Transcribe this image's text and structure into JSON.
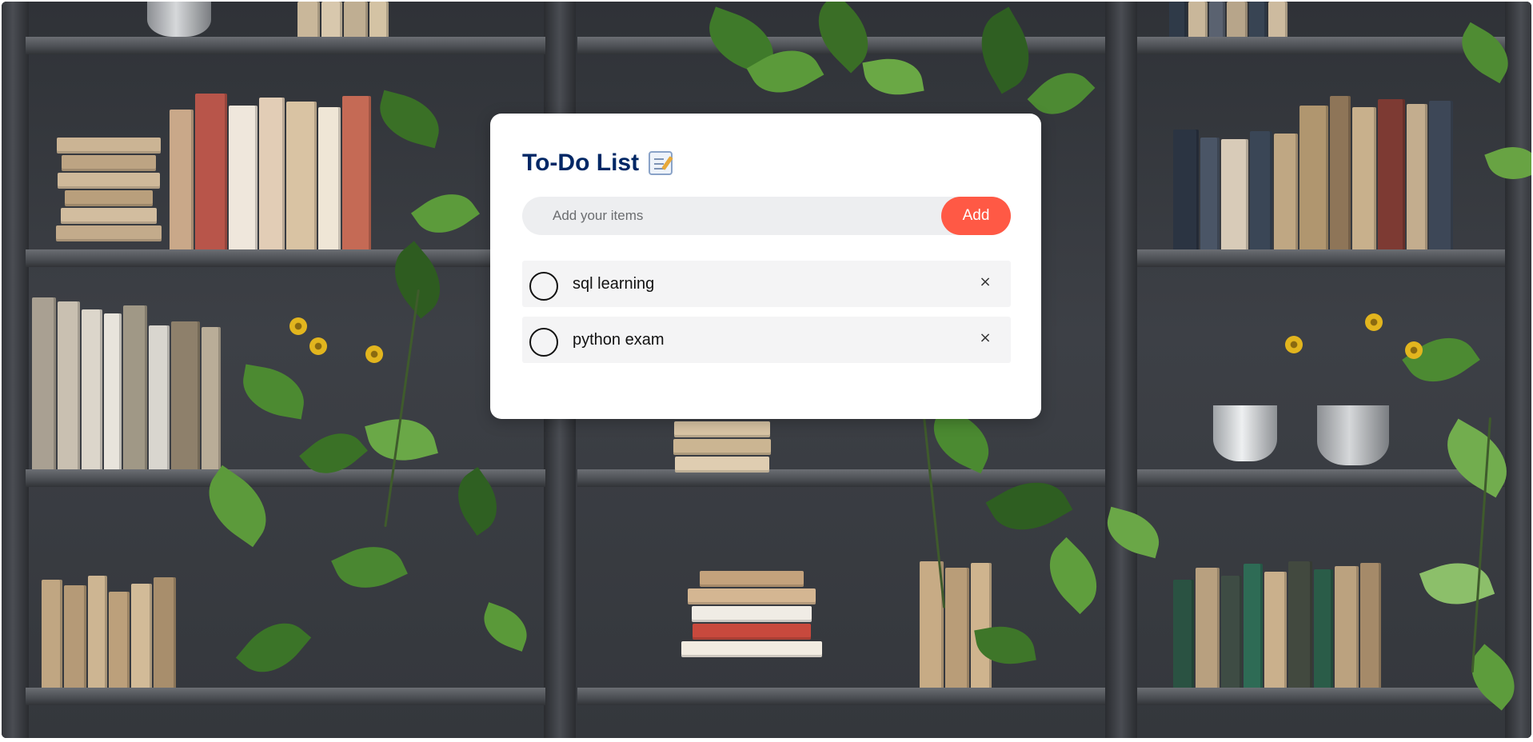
{
  "app": {
    "title": "To-Do List",
    "title_icon": "memo-icon"
  },
  "input": {
    "placeholder": "Add your items",
    "value": ""
  },
  "add_button": {
    "label": "Add"
  },
  "todos": [
    {
      "text": "sql learning",
      "done": false,
      "delete_label": "×"
    },
    {
      "text": "python exam",
      "done": false,
      "delete_label": "×"
    }
  ],
  "colors": {
    "title": "#002765",
    "accent": "#ff5945",
    "input_bg": "#edeef0",
    "item_bg": "#f4f4f5",
    "card_bg": "#ffffff"
  },
  "background": {
    "description_icon": "bookshelf-with-plants-image"
  }
}
